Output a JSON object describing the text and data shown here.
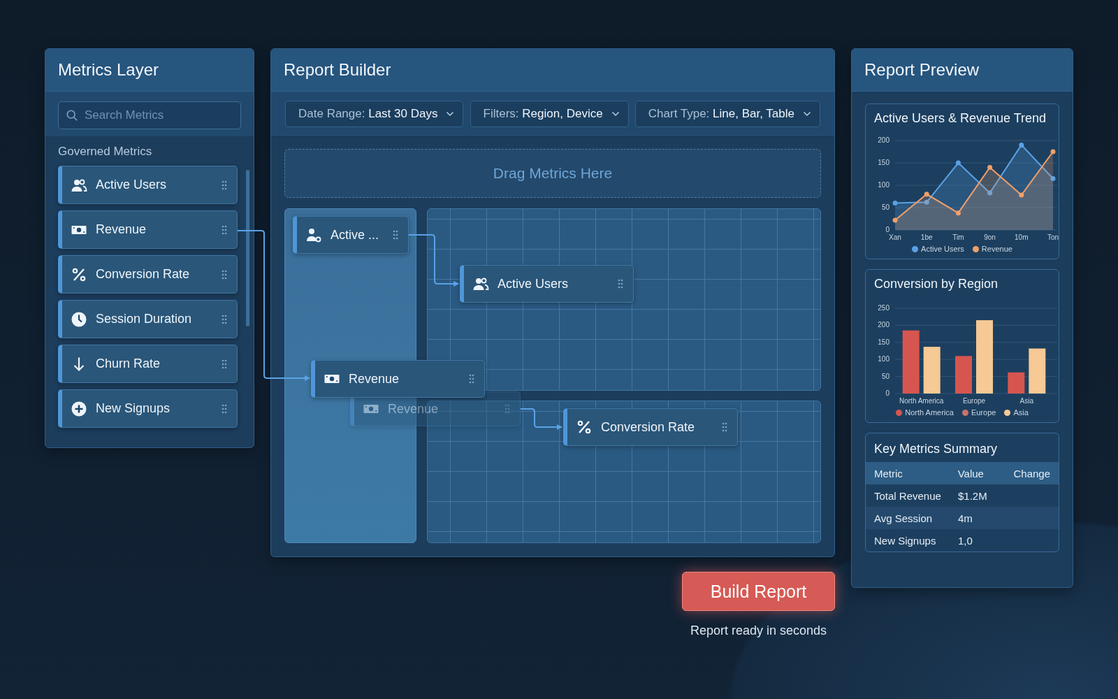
{
  "metrics_layer": {
    "title": "Metrics Layer",
    "search": {
      "placeholder": "Search Metrics"
    },
    "section": "Governed Metrics",
    "items": [
      {
        "label": "Active Users"
      },
      {
        "label": "Revenue"
      },
      {
        "label": "Conversion Rate"
      },
      {
        "label": "Session Duration"
      },
      {
        "label": "Churn Rate"
      },
      {
        "label": "New Signups"
      }
    ]
  },
  "report_builder": {
    "title": "Report Builder",
    "dropdowns": [
      {
        "label": "Date Range:",
        "value": "Last 30 Days"
      },
      {
        "label": "Filters:",
        "value": "Region, Device"
      },
      {
        "label": "Chart Type:",
        "value": "Line, Bar, Table"
      }
    ],
    "drop_zone": "Drag Metrics Here",
    "nodes": [
      {
        "label": "Active ...",
        "kind": "card"
      },
      {
        "label": "Active Users",
        "kind": "card"
      },
      {
        "label": "Revenue",
        "kind": "ghost"
      },
      {
        "label": "Revenue",
        "kind": "card"
      },
      {
        "label": "Conversion Rate",
        "kind": "card"
      }
    ]
  },
  "report_preview": {
    "title": "Report Preview",
    "trend": {
      "chart_data": {
        "type": "area",
        "title": "Active Users & Revenue Trend",
        "categories": [
          "Xan",
          "1be",
          "Tim",
          "9on",
          "10m",
          "Ton"
        ],
        "ylim": [
          0,
          200
        ],
        "yticks": [
          0,
          50,
          100,
          150,
          200
        ],
        "grid": true,
        "series": [
          {
            "name": "Active Users",
            "color": "#5aa2e6",
            "marker": "o",
            "values": [
              60,
              62,
              150,
              83,
              190,
              115
            ]
          },
          {
            "name": "Revenue",
            "color": "#f0a06a",
            "marker": "o",
            "values": [
              22,
              80,
              38,
              140,
              78,
              175
            ]
          }
        ]
      }
    },
    "conversion": {
      "chart_data": {
        "type": "bar",
        "title": "Conversion by Region",
        "categories": [
          "North America",
          "Europe",
          "Asia"
        ],
        "ylim": [
          0,
          250
        ],
        "yticks": [
          0,
          50,
          100,
          150,
          200,
          250
        ],
        "grid": true,
        "series": [
          {
            "name": "North America",
            "color": "#d6554f",
            "values": [
              185,
              110,
              62
            ]
          },
          {
            "name": "Europe",
            "color": "#c9726a",
            "values": [
              null,
              null,
              null
            ]
          },
          {
            "name": "Asia",
            "color": "#f6c995",
            "values": [
              137,
              215,
              132
            ]
          }
        ]
      }
    },
    "summary": {
      "title": "Key Metrics Summary",
      "columns": [
        "Metric",
        "Value",
        "Change"
      ],
      "rows": [
        {
          "metric": "Total Revenue",
          "value": "$1.2M"
        },
        {
          "metric": "Avg Session",
          "value": "4m"
        },
        {
          "metric": "New Signups",
          "value": "1,0"
        }
      ]
    }
  },
  "build_button": "Build Report",
  "caption": "Report ready in seconds"
}
